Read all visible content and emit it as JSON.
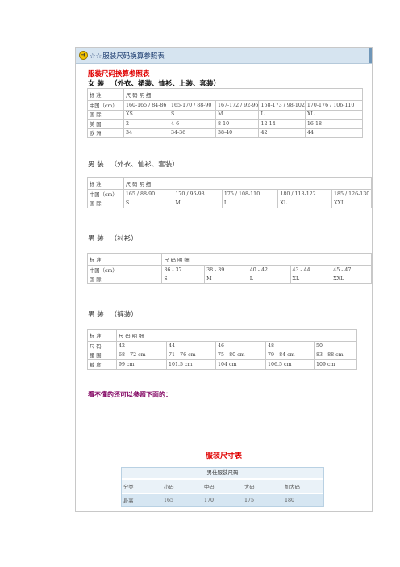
{
  "header": {
    "icon": "circle-arrow-icon",
    "prefix": "☆☆",
    "title": "服装尺码换算参照表"
  },
  "doc_title": "服装尺码换算参照表",
  "women": {
    "title": "女 装",
    "subtitle": "（外衣、裙装、恤衫、上装、套装）",
    "header": [
      "标 准",
      "尺 码 明 细"
    ],
    "rows": [
      [
        "中国（cm）",
        "160-165 / 84-86",
        "165-170 / 88-90",
        "167-172 / 92-96",
        "168-173 / 98-102",
        "170-176 / 106-110"
      ],
      [
        "国 际",
        "XS",
        "S",
        "M",
        "L",
        "XL"
      ],
      [
        "美 国",
        "2",
        "4-6",
        "8-10",
        "12-14",
        "16-18"
      ],
      [
        "欧 洲",
        "34",
        "34-36",
        "38-40",
        "42",
        "44"
      ]
    ]
  },
  "men_outer": {
    "title": "男 装",
    "subtitle": "（外衣、恤衫、套装）",
    "header": [
      "标 准",
      "尺 码 明 细"
    ],
    "rows": [
      [
        "中国（cm）",
        "165 / 88-90",
        "170 / 96-98",
        "175 / 108-110",
        "180 / 118-122",
        "185 / 126-130"
      ],
      [
        "国 际",
        "S",
        "M",
        "L",
        "XL",
        "XXL"
      ]
    ]
  },
  "men_shirt": {
    "title": "男 装",
    "subtitle": "（衬衫）",
    "header": [
      "标 准",
      "尺 码 明 细"
    ],
    "rows": [
      [
        "中国（cm）",
        "36 - 37",
        "38 - 39",
        "40 - 42",
        "43 - 44",
        "45 - 47"
      ],
      [
        "国 际",
        "S",
        "M",
        "L",
        "XL",
        "XXL"
      ]
    ]
  },
  "men_pants": {
    "title": "男 装",
    "subtitle": "（裤装）",
    "header": [
      "标 准",
      "尺 码 明 细"
    ],
    "rows": [
      [
        "尺 码",
        "42",
        "44",
        "46",
        "48",
        "50"
      ],
      [
        "腰 围",
        "68 - 72 cm",
        "71 - 76 cm",
        "75 - 80 cm",
        "79 - 84 cm",
        "83 - 88 cm"
      ],
      [
        "裤 度",
        "99 cm",
        "101.5 cm",
        "104 cm",
        "106.5 cm",
        "109 cm"
      ]
    ]
  },
  "note": "看不懂的还可以参照下面的：",
  "chart_title": "服装尺寸表",
  "mens_chart": {
    "title": "男仕服装尺码",
    "header": [
      "分类",
      "小码",
      "中码",
      "大码",
      "加大码"
    ],
    "row": [
      "身高",
      "165",
      "170",
      "175",
      "180"
    ]
  },
  "colors": {
    "accent_red": "#e00000",
    "note_purple": "#800060",
    "header_blue": "#d6e4f0"
  }
}
